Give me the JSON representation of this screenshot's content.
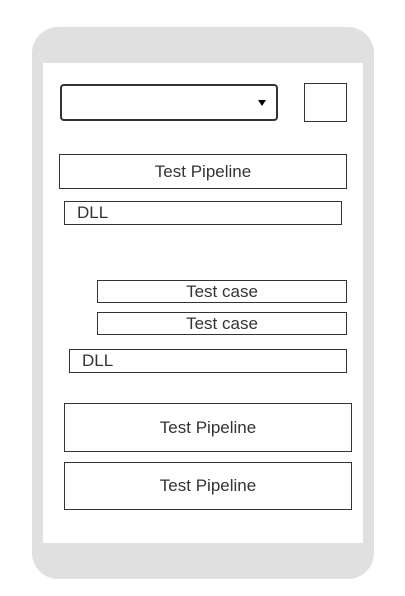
{
  "dropdown": {
    "value": ""
  },
  "pipeline_top": {
    "label": "Test Pipeline"
  },
  "dll_first": {
    "label": "DLL"
  },
  "test_cases": [
    {
      "label": "Test case"
    },
    {
      "label": "Test case"
    }
  ],
  "dll_second": {
    "label": "DLL"
  },
  "pipelines_bottom": [
    {
      "label": "Test Pipeline"
    },
    {
      "label": "Test Pipeline"
    }
  ]
}
